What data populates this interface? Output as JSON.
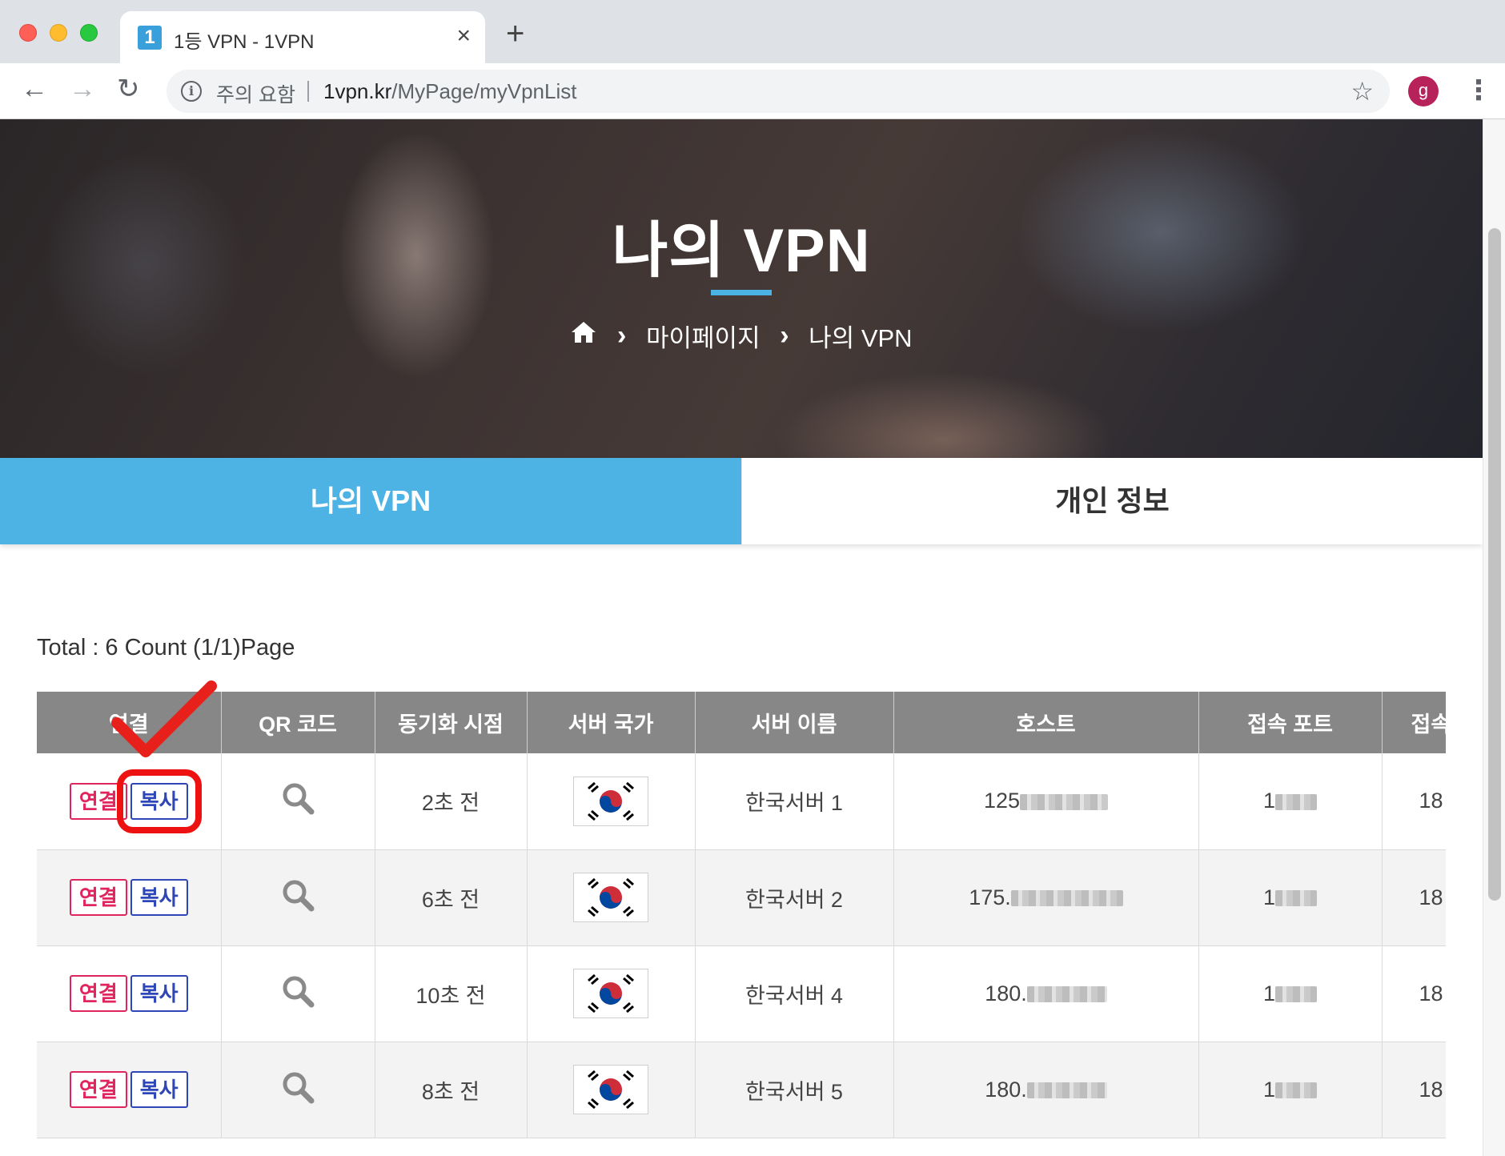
{
  "browser": {
    "tab_title": "1등 VPN - 1VPN",
    "favicon_text": "1",
    "close_icon": "×",
    "new_tab_icon": "+",
    "back_icon": "←",
    "forward_icon": "→",
    "reload_icon": "↻",
    "security_label": "주의 요함",
    "url_host": "1vpn.kr",
    "url_path": "/MyPage/myVpnList",
    "star_icon": "☆",
    "profile_initial": "g",
    "menu_icon": "⋮"
  },
  "hero": {
    "title": "나의 VPN",
    "breadcrumb": [
      "마이페이지",
      "나의 VPN"
    ],
    "home_icon": "⌂",
    "separator_icon": "›"
  },
  "tabs": {
    "active": "나의 VPN",
    "inactive": "개인 정보"
  },
  "total_text": "Total : 6 Count (1/1)Page",
  "table": {
    "headers": [
      "연결",
      "QR 코드",
      "동기화 시점",
      "서버 국가",
      "서버 이름",
      "호스트",
      "접속 포트",
      "접속"
    ],
    "connect_label": "연결",
    "copy_label": "복사",
    "rows": [
      {
        "sync": "2초 전",
        "country": "south-korea-flag",
        "name": "한국서버 1",
        "host": "125",
        "port": "1",
        "last": "18"
      },
      {
        "sync": "6초 전",
        "country": "south-korea-flag",
        "name": "한국서버 2",
        "host": "175.",
        "port": "1",
        "last": "18"
      },
      {
        "sync": "10초 전",
        "country": "south-korea-flag",
        "name": "한국서버 4",
        "host": "180.",
        "port": "1",
        "last": "18"
      },
      {
        "sync": "8초 전",
        "country": "south-korea-flag",
        "name": "한국서버 5",
        "host": "180.",
        "port": "1",
        "last": "18"
      }
    ]
  },
  "colors": {
    "accent": "#4db3e4",
    "connect": "#e0245e",
    "copy": "#2e46b8",
    "highlight": "#ee1111"
  }
}
